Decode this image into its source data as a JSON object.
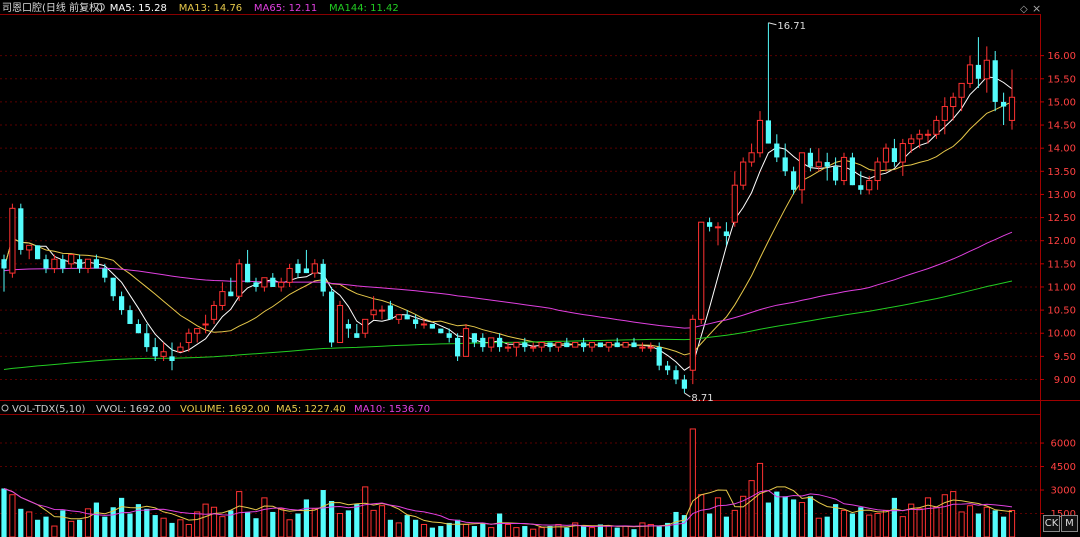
{
  "header": {
    "title": "司恩口腔(日线 前复权)",
    "items": [
      {
        "label": "MA5: 15.28",
        "color": "#ffffff"
      },
      {
        "label": "MA13: 14.76",
        "color": "#e6c84a"
      },
      {
        "label": "MA65: 12.11",
        "color": "#e040e0"
      },
      {
        "label": "MA144: 11.42",
        "color": "#22cc22"
      }
    ]
  },
  "volume_header": {
    "items": [
      {
        "label": "VOL-TDX(5,10)",
        "color": "#cccccc"
      },
      {
        "label": "VVOL: 1692.00",
        "color": "#cccccc"
      },
      {
        "label": "VOLUME: 1692.00",
        "color": "#e6c84a"
      },
      {
        "label": "MA5: 1227.40",
        "color": "#e6c84a"
      },
      {
        "label": "MA10: 1536.70",
        "color": "#e040e0"
      }
    ]
  },
  "buttons": {
    "ck": "CK",
    "m": "M"
  },
  "colors": {
    "up": "#ff3232",
    "down": "#54fcfc",
    "grid": "#5a0000"
  },
  "chart_data": {
    "type": "candlestick",
    "price_axis": {
      "ylim": [
        8.6,
        16.9
      ],
      "ticks": [
        "16.00",
        "15.50",
        "15.00",
        "14.50",
        "14.00",
        "13.50",
        "13.00",
        "12.50",
        "12.00",
        "11.50",
        "11.00",
        "10.50",
        "10.00",
        "9.50",
        "9.00"
      ]
    },
    "volume_axis": {
      "ylim": [
        0,
        7600
      ],
      "ticks": [
        "6000",
        "4500",
        "3000",
        "1500"
      ]
    },
    "annotations": [
      {
        "label": "16.71",
        "bar_index": 91,
        "value": 16.71
      },
      {
        "label": "8.71",
        "bar_index": 81,
        "value": 8.71
      }
    ],
    "ohlc": [
      [
        11.6,
        11.7,
        10.9,
        11.4
      ],
      [
        11.3,
        12.8,
        11.2,
        12.7
      ],
      [
        12.7,
        12.8,
        11.7,
        11.8
      ],
      [
        11.8,
        11.9,
        11.6,
        11.9
      ],
      [
        11.9,
        11.9,
        11.6,
        11.6
      ],
      [
        11.6,
        11.7,
        11.3,
        11.4
      ],
      [
        11.4,
        11.7,
        11.3,
        11.6
      ],
      [
        11.6,
        11.7,
        11.3,
        11.4
      ],
      [
        11.5,
        11.7,
        11.4,
        11.7
      ],
      [
        11.6,
        11.7,
        11.3,
        11.4
      ],
      [
        11.4,
        11.6,
        11.3,
        11.6
      ],
      [
        11.6,
        11.7,
        11.4,
        11.4
      ],
      [
        11.4,
        11.5,
        11.1,
        11.2
      ],
      [
        11.2,
        11.2,
        10.7,
        10.8
      ],
      [
        10.8,
        10.9,
        10.4,
        10.5
      ],
      [
        10.5,
        10.6,
        10.2,
        10.2
      ],
      [
        10.2,
        10.3,
        10.0,
        10.0
      ],
      [
        10.0,
        10.2,
        9.6,
        9.7
      ],
      [
        9.7,
        9.9,
        9.4,
        9.5
      ],
      [
        9.5,
        9.8,
        9.4,
        9.6
      ],
      [
        9.5,
        9.8,
        9.2,
        9.4
      ],
      [
        9.6,
        9.8,
        9.6,
        9.7
      ],
      [
        9.8,
        10.1,
        9.6,
        10.0
      ],
      [
        10.0,
        10.1,
        9.8,
        10.1
      ],
      [
        10.2,
        10.4,
        10.0,
        10.2
      ],
      [
        10.3,
        10.7,
        10.2,
        10.6
      ],
      [
        10.6,
        11.1,
        10.5,
        10.9
      ],
      [
        10.9,
        11.2,
        10.8,
        10.8
      ],
      [
        10.8,
        11.6,
        10.7,
        11.5
      ],
      [
        11.5,
        11.8,
        11.1,
        11.1
      ],
      [
        11.1,
        11.2,
        10.9,
        11.0
      ],
      [
        11.0,
        11.2,
        10.9,
        11.2
      ],
      [
        11.2,
        11.3,
        11.0,
        11.0
      ],
      [
        11.0,
        11.2,
        10.9,
        11.1
      ],
      [
        11.1,
        11.5,
        11.0,
        11.4
      ],
      [
        11.5,
        11.6,
        11.2,
        11.3
      ],
      [
        11.4,
        11.8,
        11.3,
        11.3
      ],
      [
        11.3,
        11.6,
        11.2,
        11.5
      ],
      [
        11.5,
        11.6,
        10.8,
        10.9
      ],
      [
        10.9,
        11.0,
        9.7,
        9.8
      ],
      [
        9.8,
        10.7,
        9.8,
        10.6
      ],
      [
        10.2,
        10.3,
        9.9,
        10.1
      ],
      [
        10.0,
        10.2,
        9.9,
        9.9
      ],
      [
        10.0,
        10.3,
        9.9,
        10.3
      ],
      [
        10.4,
        10.8,
        10.3,
        10.5
      ],
      [
        10.5,
        10.6,
        10.3,
        10.5
      ],
      [
        10.6,
        10.7,
        10.3,
        10.3
      ],
      [
        10.3,
        10.4,
        10.2,
        10.4
      ],
      [
        10.4,
        10.5,
        10.3,
        10.3
      ],
      [
        10.3,
        10.4,
        10.1,
        10.2
      ],
      [
        10.2,
        10.3,
        10.1,
        10.2
      ],
      [
        10.2,
        10.2,
        10.1,
        10.1
      ],
      [
        10.1,
        10.1,
        10.0,
        10.0
      ],
      [
        10.0,
        10.1,
        9.8,
        9.9
      ],
      [
        9.9,
        10.0,
        9.4,
        9.5
      ],
      [
        9.5,
        10.2,
        9.5,
        10.1
      ],
      [
        10.0,
        10.0,
        9.7,
        9.8
      ],
      [
        9.9,
        10.0,
        9.6,
        9.7
      ],
      [
        9.7,
        9.9,
        9.6,
        9.9
      ],
      [
        9.9,
        10.0,
        9.6,
        9.7
      ],
      [
        9.7,
        9.8,
        9.6,
        9.7
      ],
      [
        9.7,
        9.8,
        9.5,
        9.8
      ],
      [
        9.8,
        9.9,
        9.6,
        9.7
      ],
      [
        9.7,
        9.8,
        9.6,
        9.7
      ],
      [
        9.7,
        9.8,
        9.6,
        9.8
      ],
      [
        9.8,
        9.8,
        9.6,
        9.7
      ],
      [
        9.7,
        9.8,
        9.6,
        9.8
      ],
      [
        9.8,
        9.9,
        9.7,
        9.7
      ],
      [
        9.7,
        9.8,
        9.7,
        9.8
      ],
      [
        9.8,
        9.9,
        9.6,
        9.7
      ],
      [
        9.7,
        9.8,
        9.6,
        9.8
      ],
      [
        9.8,
        9.8,
        9.7,
        9.7
      ],
      [
        9.7,
        9.8,
        9.6,
        9.8
      ],
      [
        9.8,
        9.9,
        9.7,
        9.7
      ],
      [
        9.7,
        9.8,
        9.7,
        9.8
      ],
      [
        9.8,
        9.9,
        9.7,
        9.7
      ],
      [
        9.7,
        9.8,
        9.6,
        9.7
      ],
      [
        9.7,
        9.8,
        9.6,
        9.7
      ],
      [
        9.7,
        9.8,
        9.2,
        9.3
      ],
      [
        9.3,
        9.4,
        9.1,
        9.2
      ],
      [
        9.2,
        9.3,
        8.9,
        9.0
      ],
      [
        9.0,
        9.1,
        8.71,
        8.8
      ],
      [
        9.2,
        10.4,
        8.9,
        10.3
      ],
      [
        10.3,
        12.4,
        10.2,
        12.4
      ],
      [
        12.4,
        12.5,
        12.2,
        12.3
      ],
      [
        12.3,
        12.4,
        11.9,
        12.3
      ],
      [
        12.2,
        12.4,
        11.9,
        12.1
      ],
      [
        12.4,
        13.5,
        12.3,
        13.2
      ],
      [
        13.2,
        13.8,
        13.1,
        13.7
      ],
      [
        13.7,
        14.1,
        13.6,
        13.9
      ],
      [
        13.9,
        14.8,
        13.8,
        14.6
      ],
      [
        14.6,
        16.71,
        14.1,
        14.1
      ],
      [
        14.1,
        14.3,
        13.7,
        13.8
      ],
      [
        13.8,
        14.1,
        13.4,
        13.5
      ],
      [
        13.5,
        13.6,
        13.0,
        13.1
      ],
      [
        13.1,
        13.9,
        12.8,
        13.9
      ],
      [
        13.9,
        14.0,
        13.5,
        13.6
      ],
      [
        13.6,
        14.0,
        13.5,
        13.7
      ],
      [
        13.7,
        13.9,
        13.3,
        13.6
      ],
      [
        13.6,
        13.8,
        13.2,
        13.3
      ],
      [
        13.3,
        13.9,
        13.2,
        13.8
      ],
      [
        13.8,
        13.9,
        13.2,
        13.2
      ],
      [
        13.2,
        13.5,
        13.0,
        13.1
      ],
      [
        13.1,
        13.4,
        13.0,
        13.3
      ],
      [
        13.3,
        13.8,
        13.1,
        13.7
      ],
      [
        13.7,
        14.1,
        13.5,
        14.0
      ],
      [
        14.0,
        14.2,
        13.6,
        13.7
      ],
      [
        13.7,
        14.2,
        13.4,
        14.1
      ],
      [
        14.1,
        14.3,
        13.9,
        14.2
      ],
      [
        14.2,
        14.4,
        14.0,
        14.3
      ],
      [
        14.3,
        14.4,
        14.1,
        14.3
      ],
      [
        14.3,
        14.7,
        14.2,
        14.6
      ],
      [
        14.6,
        15.1,
        14.3,
        14.9
      ],
      [
        14.9,
        15.2,
        14.6,
        15.1
      ],
      [
        15.1,
        15.4,
        14.8,
        15.4
      ],
      [
        15.4,
        16.0,
        15.3,
        15.8
      ],
      [
        15.8,
        16.4,
        15.3,
        15.5
      ],
      [
        15.5,
        16.2,
        15.2,
        15.9
      ],
      [
        15.9,
        16.1,
        14.8,
        15.0
      ],
      [
        15.0,
        15.2,
        14.5,
        14.9
      ],
      [
        14.6,
        15.7,
        14.4,
        15.1
      ]
    ],
    "volume": [
      3100,
      2700,
      1800,
      1600,
      1100,
      1300,
      700,
      1700,
      1000,
      1100,
      1800,
      2200,
      1300,
      1900,
      2500,
      1500,
      2100,
      1800,
      1400,
      1200,
      900,
      1100,
      800,
      1600,
      2100,
      1900,
      1300,
      1700,
      2900,
      1600,
      1200,
      2500,
      1600,
      1800,
      1100,
      1500,
      2400,
      1800,
      3000,
      2300,
      1500,
      1700,
      2100,
      3200,
      1700,
      2000,
      1100,
      900,
      1400,
      1100,
      800,
      600,
      700,
      900,
      1100,
      800,
      700,
      900,
      600,
      1500,
      800,
      600,
      700,
      500,
      600,
      700,
      800,
      600,
      900,
      700,
      600,
      800,
      700,
      600,
      700,
      500,
      900,
      800,
      700,
      900,
      1600,
      1400,
      6900,
      2700,
      1500,
      2500,
      1300,
      1700,
      2600,
      3600,
      4700,
      2200,
      2900,
      2600,
      2400,
      2200,
      2600,
      1200,
      1300,
      2100,
      1700,
      1500,
      1900,
      1400,
      1500,
      1700,
      2500,
      1300,
      2100,
      1800,
      2500,
      1900,
      2700,
      2900,
      1600,
      2000,
      1500,
      1900,
      1700,
      1300,
      1692
    ]
  }
}
